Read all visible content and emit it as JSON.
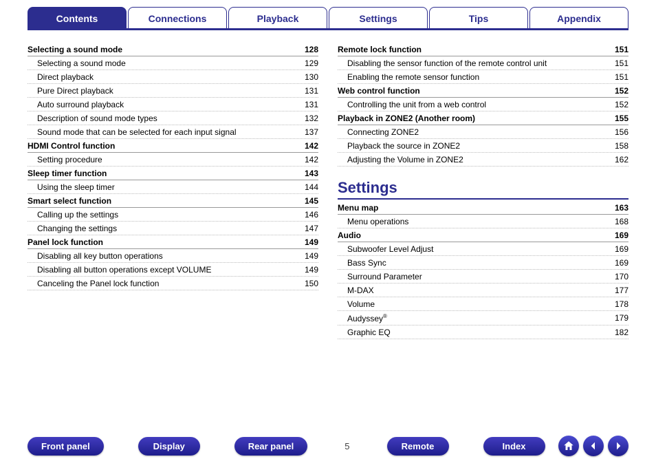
{
  "tabs": {
    "contents": "Contents",
    "connections": "Connections",
    "playback": "Playback",
    "settings": "Settings",
    "tips": "Tips",
    "appendix": "Appendix",
    "active": "contents"
  },
  "page_number": "5",
  "left_column": {
    "sections": [
      {
        "title": "Selecting a sound mode",
        "page": "128",
        "items": [
          {
            "label": "Selecting a sound mode",
            "page": "129"
          },
          {
            "label": "Direct playback",
            "page": "130"
          },
          {
            "label": "Pure Direct playback",
            "page": "131"
          },
          {
            "label": "Auto surround playback",
            "page": "131"
          },
          {
            "label": "Description of sound mode types",
            "page": "132"
          },
          {
            "label": "Sound mode that can be selected for each input signal",
            "page": "137"
          }
        ]
      },
      {
        "title": "HDMI Control function",
        "page": "142",
        "items": [
          {
            "label": "Setting procedure",
            "page": "142"
          }
        ]
      },
      {
        "title": "Sleep timer function",
        "page": "143",
        "items": [
          {
            "label": "Using the sleep timer",
            "page": "144"
          }
        ]
      },
      {
        "title": "Smart select function",
        "page": "145",
        "items": [
          {
            "label": "Calling up the settings",
            "page": "146"
          },
          {
            "label": "Changing the settings",
            "page": "147"
          }
        ]
      },
      {
        "title": "Panel lock function",
        "page": "149",
        "items": [
          {
            "label": "Disabling all key button operations",
            "page": "149"
          },
          {
            "label": "Disabling all button operations except VOLUME",
            "page": "149"
          },
          {
            "label": "Canceling the Panel lock function",
            "page": "150"
          }
        ]
      }
    ]
  },
  "right_column": {
    "top_sections": [
      {
        "title": "Remote lock function",
        "page": "151",
        "items": [
          {
            "label": "Disabling the sensor function of the remote control unit",
            "page": "151"
          },
          {
            "label": "Enabling the remote sensor function",
            "page": "151"
          }
        ]
      },
      {
        "title": "Web control function",
        "page": "152",
        "items": [
          {
            "label": "Controlling the unit from a web control",
            "page": "152"
          }
        ]
      },
      {
        "title": "Playback in ZONE2 (Another room)",
        "page": "155",
        "items": [
          {
            "label": "Connecting ZONE2",
            "page": "156"
          },
          {
            "label": "Playback the source in ZONE2",
            "page": "158"
          },
          {
            "label": "Adjusting the Volume in ZONE2",
            "page": "162"
          }
        ]
      }
    ],
    "chapter_heading": "Settings",
    "settings_sections": [
      {
        "title": "Menu map",
        "page": "163",
        "items": [
          {
            "label": "Menu operations",
            "page": "168"
          }
        ]
      },
      {
        "title": "Audio",
        "page": "169",
        "items": [
          {
            "label": "Subwoofer Level Adjust",
            "page": "169"
          },
          {
            "label": "Bass Sync",
            "page": "169"
          },
          {
            "label": "Surround Parameter",
            "page": "170"
          },
          {
            "label": "M-DAX",
            "page": "177"
          },
          {
            "label": "Volume",
            "page": "178"
          },
          {
            "label": "Audyssey",
            "sup": "®",
            "page": "179"
          },
          {
            "label": "Graphic EQ",
            "page": "182"
          }
        ]
      }
    ]
  },
  "footer": {
    "buttons": {
      "front_panel": "Front panel",
      "display": "Display",
      "rear_panel": "Rear panel",
      "remote": "Remote",
      "index": "Index"
    },
    "icons": {
      "home": "home-icon",
      "prev": "arrow-left-icon",
      "next": "arrow-right-icon"
    }
  }
}
